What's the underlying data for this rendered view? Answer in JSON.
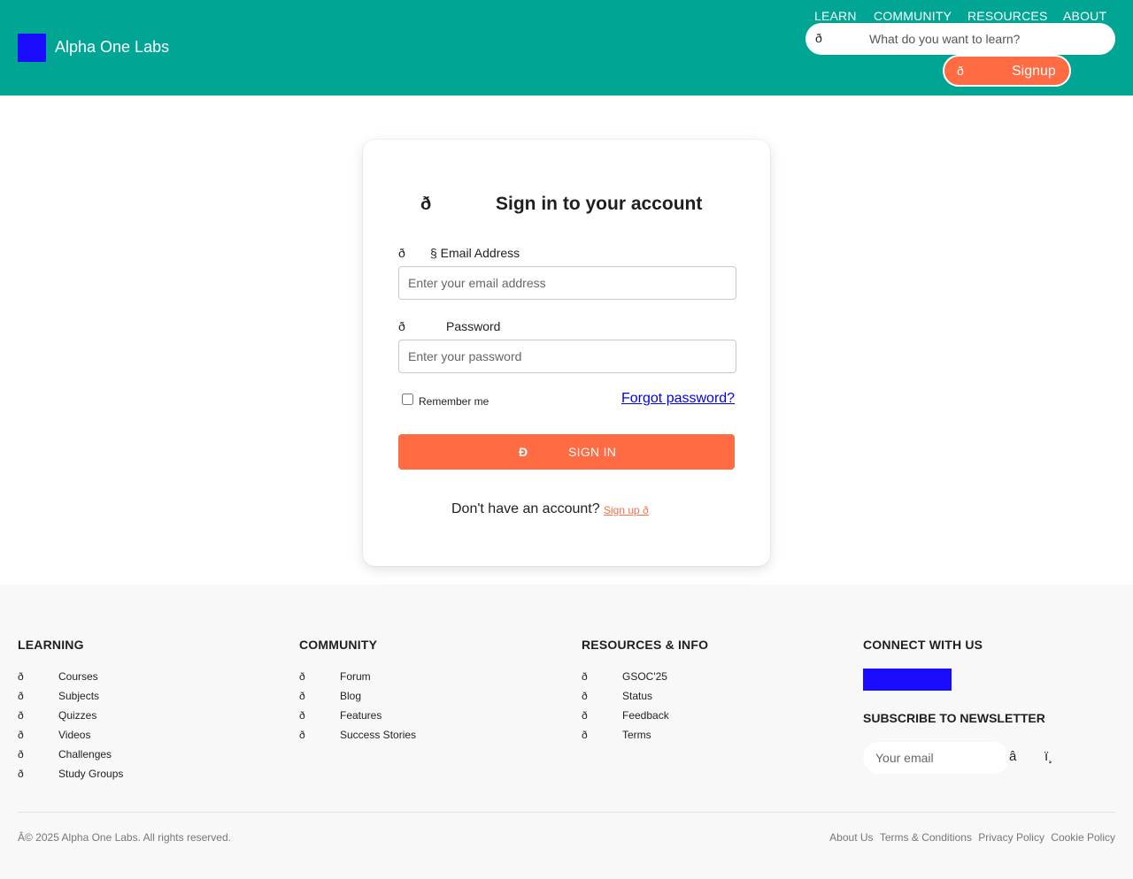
{
  "header": {
    "logo_text": "Alpha One Labs",
    "nav": [
      "LEARN",
      "COMMUNITY",
      "RESOURCES",
      "ABOUT"
    ],
    "search_icon": "ð",
    "search_placeholder": "What do you want to learn?",
    "signup_icon": "ð",
    "signup_label": "Signup"
  },
  "login": {
    "title_icon": "ð",
    "title": "Sign in to your account",
    "email_icon": "ð",
    "email_label": "§ Email Address",
    "email_placeholder": "Enter your email address",
    "password_icon": "ð",
    "password_label": "Password",
    "password_placeholder": "Enter your password",
    "remember_label": "Remember me",
    "forgot_label": "Forgot password?",
    "signin_icon": "Ð",
    "signin_label": "SIGN IN",
    "no_account_text": "Don't have an account?",
    "signup_link": "Sign up ð"
  },
  "footer": {
    "learning": {
      "title": "LEARNING",
      "items": [
        {
          "icon": "ð",
          "label": "Courses"
        },
        {
          "icon": "ð",
          "label": "Subjects"
        },
        {
          "icon": "ð",
          "label": "Quizzes"
        },
        {
          "icon": "ð",
          "label": "Videos"
        },
        {
          "icon": "ð",
          "label": "Challenges"
        },
        {
          "icon": "ð",
          "label": "Study Groups"
        }
      ]
    },
    "community": {
      "title": "COMMUNITY",
      "items": [
        {
          "icon": "ð",
          "label": "Forum"
        },
        {
          "icon": "ð",
          "label": "Blog"
        },
        {
          "icon": "ð",
          "label": "Features"
        },
        {
          "icon": "ð",
          "label": "Success Stories"
        }
      ]
    },
    "resources": {
      "title": "RESOURCES & INFO",
      "items": [
        {
          "icon": "ð",
          "label": "GSOC'25"
        },
        {
          "icon": "ð",
          "label": "Status"
        },
        {
          "icon": "ð",
          "label": "Feedback"
        },
        {
          "icon": "ð",
          "label": "Terms"
        }
      ]
    },
    "connect_title": "CONNECT WITH US",
    "newsletter_title": "SUBSCRIBE TO NEWSLETTER",
    "newsletter_placeholder": "Your email",
    "newsletter_icon_1": "â",
    "newsletter_icon_2": "ï¸",
    "copyright": "Â© 2025 Alpha One Labs. All rights reserved.",
    "legal": [
      "About Us",
      "Terms & Conditions",
      "Privacy Policy",
      "Cookie Policy"
    ]
  },
  "colors": {
    "header_bg": "#00a693",
    "accent": "#ff6b42",
    "logo": "#1a0dff"
  }
}
